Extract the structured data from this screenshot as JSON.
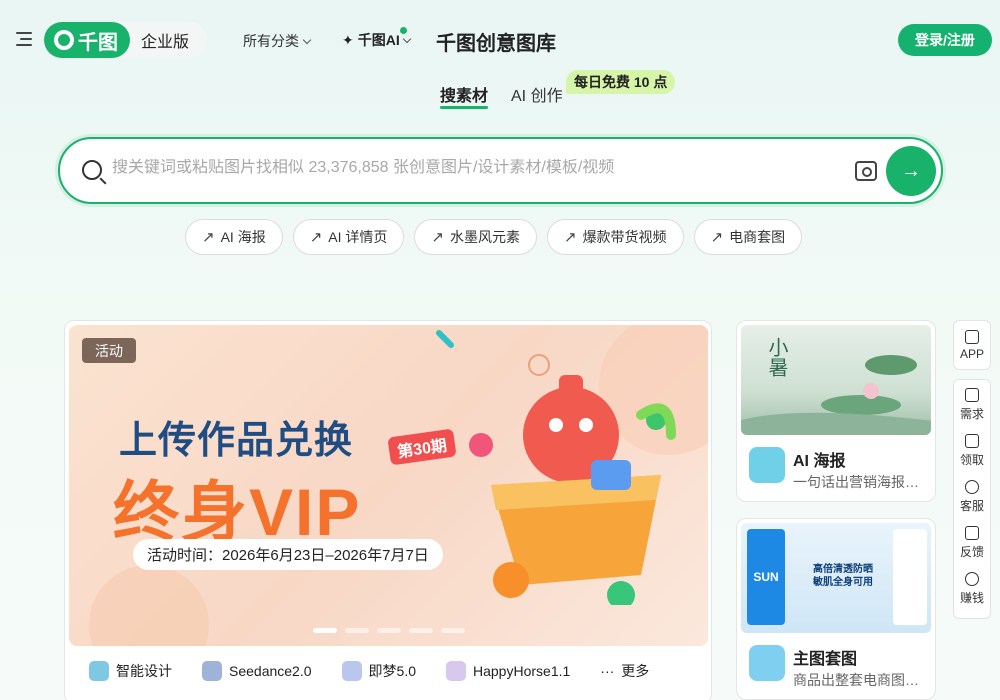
{
  "header": {
    "brand_logo_text": "千图",
    "brand_edition": "企业版",
    "nav_category": "所有分类",
    "nav_ai": "千图AI",
    "site_title": "千图创意图库",
    "login_label": "登录/注册"
  },
  "tabs": {
    "search_tab": "搜素材",
    "ai_tab": "AI 创作",
    "promo_badge": "每日免费 10 点"
  },
  "search": {
    "placeholder": "搜关键词或粘贴图片找相似 23,376,858 张创意图片/设计素材/模板/视频",
    "value": ""
  },
  "hot_chips": [
    {
      "label": "AI 海报"
    },
    {
      "label": "AI 详情页"
    },
    {
      "label": "水墨风元素"
    },
    {
      "label": "爆款带货视频"
    },
    {
      "label": "电商套图"
    }
  ],
  "banner": {
    "tag": "活动",
    "headline_1": "上传作品兑换",
    "headline_2": "终身VIP",
    "period_badge": "第30期",
    "dates": "活动时间：2026年6月23日–2026年7月7日",
    "slide_count": 5,
    "active_slide": 1
  },
  "tools": [
    {
      "label": "智能设计",
      "color": "#7ec8e3"
    },
    {
      "label": "Seedance2.0",
      "color": "#9fb3d9"
    },
    {
      "label": "即梦5.0",
      "color": "#b9c6ee"
    },
    {
      "label": "HappyHorse1.1",
      "color": "#d9c8ee"
    },
    {
      "label": "更多",
      "icon": "ellipsis-icon"
    }
  ],
  "side_cards": [
    {
      "title": "AI 海报",
      "desc": "一句话出营销海报，秒出",
      "thumb_text": "小暑",
      "icon_color": "#6fd0e8"
    },
    {
      "title": "主图套图",
      "desc": "商品出整套电商图，一键生成",
      "thumb_text": "高倍清透防晒 敏肌全身可用",
      "thumb_sub": "SUN",
      "icon_color": "#7fd0f0"
    }
  ],
  "rail": {
    "app": "APP",
    "items": [
      "需求",
      "领取",
      "客服",
      "反馈",
      "赚钱"
    ]
  },
  "colors": {
    "brand_green": "#19b26b",
    "badge_bg": "#d6f5a9"
  }
}
